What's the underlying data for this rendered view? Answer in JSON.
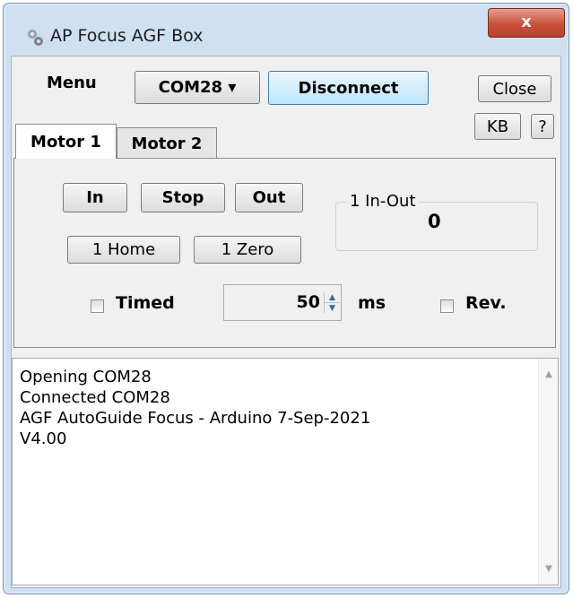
{
  "window": {
    "title": "AP Focus AGF Box",
    "close_glyph": "x"
  },
  "toolbar": {
    "menu_label": "Menu",
    "port_value": "COM28 ▾",
    "disconnect_label": "Disconnect",
    "close_label": "Close",
    "kb_label": "KB",
    "help_label": "?"
  },
  "tabs": [
    {
      "label": "Motor 1",
      "active": true
    },
    {
      "label": "Motor 2",
      "active": false
    }
  ],
  "motor": {
    "in_label": "In",
    "stop_label": "Stop",
    "out_label": "Out",
    "home_label": "1 Home",
    "zero_label": "1 Zero",
    "inout_group_label": "1 In-Out",
    "inout_value": "0",
    "timed_label": "Timed",
    "timed_checked": false,
    "ms_value": "50",
    "ms_label": "ms",
    "rev_label": "Rev.",
    "rev_checked": false
  },
  "log": {
    "lines": [
      "Opening COM28",
      "Connected COM28",
      "AGF AutoGuide Focus - Arduino 7-Sep-2021",
      "V4.00"
    ]
  },
  "colors": {
    "frame": "#cfe0f3",
    "client": "#f0f0f0",
    "close_red": "#c9503a",
    "spin_arrow": "#2e6aa1"
  }
}
